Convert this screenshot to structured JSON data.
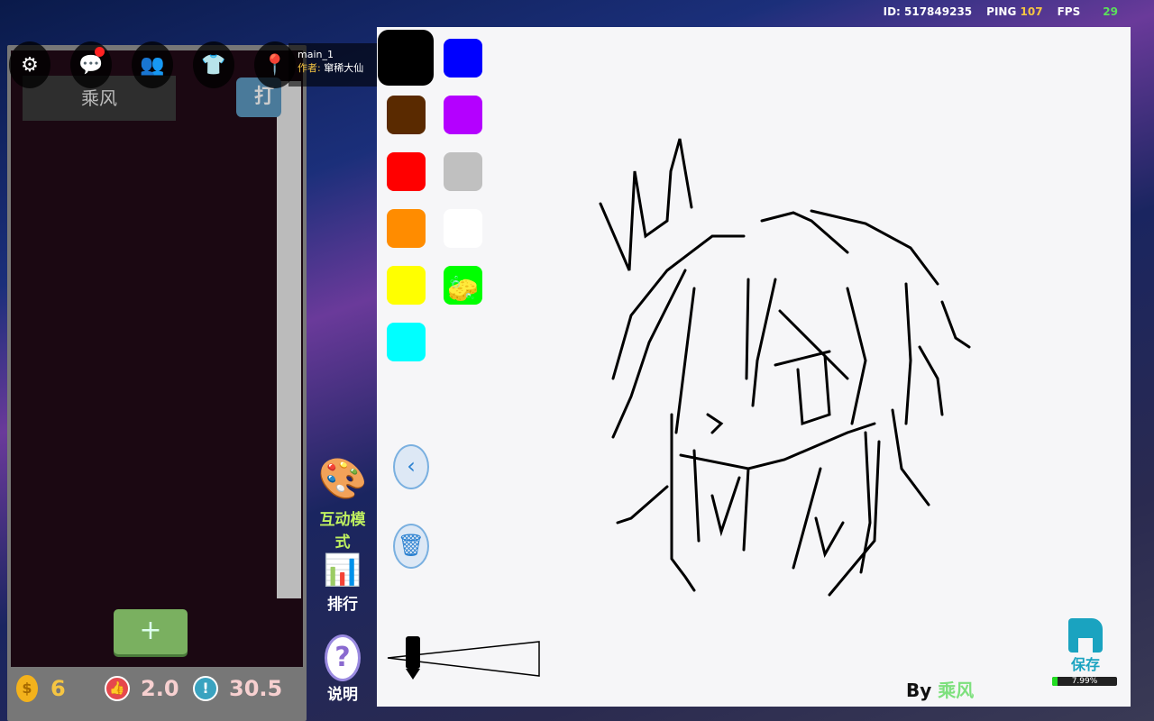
{
  "status": {
    "id_label": "ID: 517849235",
    "ping_label": "PING",
    "ping": "107",
    "fps_label": "FPS",
    "fps": "29"
  },
  "left": {
    "tab_active": "乘风",
    "tab_other": "打",
    "add_label": "+"
  },
  "map": {
    "name": "main_1",
    "author_label": "作者:",
    "author": "窜稀大仙"
  },
  "stats": {
    "coins": "6",
    "likes": "2.0",
    "warn": "30.5"
  },
  "side": {
    "interactive": "互动模式",
    "rank": "排行",
    "help": "说明"
  },
  "palette": {
    "colors": [
      "#000000",
      "#0000ff",
      "#5a2a00",
      "#b400ff",
      "#ff0000",
      "#c0c0c0",
      "#ff8c00",
      "#ffffff",
      "#ffff00",
      "#00ff00",
      "#00ffff"
    ],
    "selected": "#000000"
  },
  "canvas": {
    "by_label": "By",
    "by_name": "乘风",
    "save_label": "保存",
    "progress_text": "7.99%",
    "progress": 7.99
  }
}
